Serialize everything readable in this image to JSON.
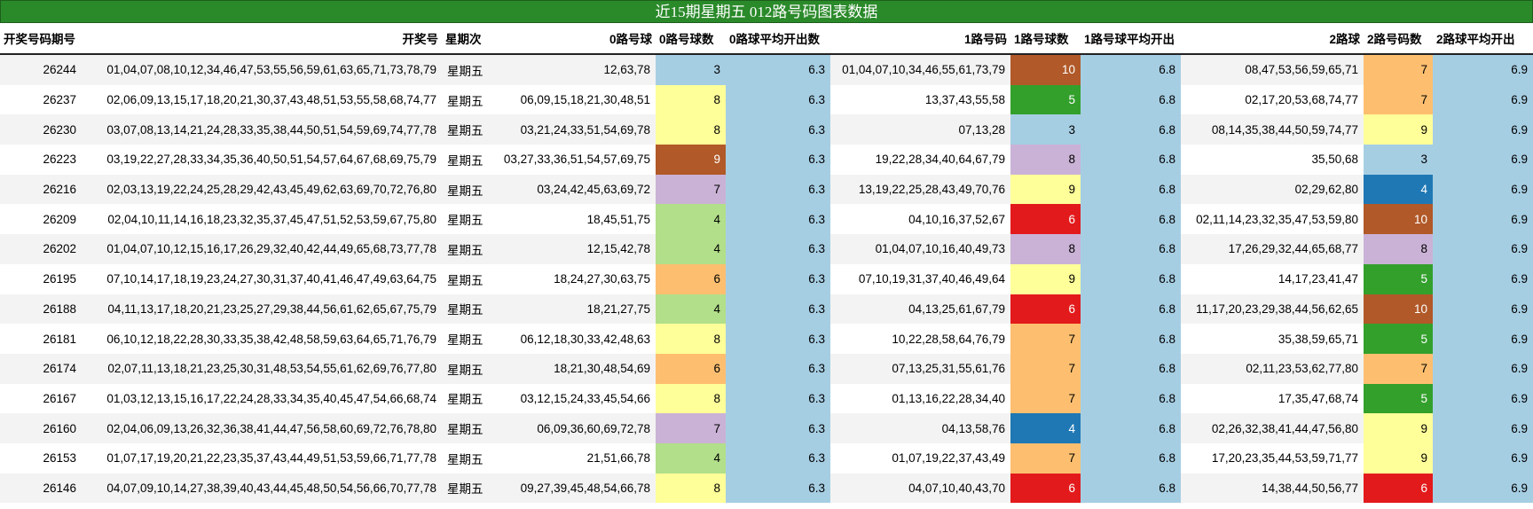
{
  "title": "近15期星期五 012路号码图表数据",
  "headers": [
    "开奖号码期号",
    "开奖号",
    "星期次",
    "0路号球",
    "0路号球数",
    "0路球平均开出数",
    "1路号码",
    "1路号球数",
    "1路号球平均开出",
    "2路球",
    "2路号码数",
    "2路球平均开出"
  ],
  "rows": [
    {
      "issue": "26244",
      "numbers": "01,04,07,08,10,12,34,46,47,53,55,56,59,61,63,65,71,73,78,79",
      "weekday": "星期五",
      "r0": "12,63,78",
      "c0": "3",
      "a0": "6.3",
      "r1": "01,04,07,10,34,46,55,61,73,79",
      "c1": "10",
      "a1": "6.8",
      "r2": "08,47,53,56,59,65,71",
      "c2": "7",
      "a2": "6.9"
    },
    {
      "issue": "26237",
      "numbers": "02,06,09,13,15,17,18,20,21,30,37,43,48,51,53,55,58,68,74,77",
      "weekday": "星期五",
      "r0": "06,09,15,18,21,30,48,51",
      "c0": "8",
      "a0": "6.3",
      "r1": "13,37,43,55,58",
      "c1": "5",
      "a1": "6.8",
      "r2": "02,17,20,53,68,74,77",
      "c2": "7",
      "a2": "6.9"
    },
    {
      "issue": "26230",
      "numbers": "03,07,08,13,14,21,24,28,33,35,38,44,50,51,54,59,69,74,77,78",
      "weekday": "星期五",
      "r0": "03,21,24,33,51,54,69,78",
      "c0": "8",
      "a0": "6.3",
      "r1": "07,13,28",
      "c1": "3",
      "a1": "6.8",
      "r2": "08,14,35,38,44,50,59,74,77",
      "c2": "9",
      "a2": "6.9"
    },
    {
      "issue": "26223",
      "numbers": "03,19,22,27,28,33,34,35,36,40,50,51,54,57,64,67,68,69,75,79",
      "weekday": "星期五",
      "r0": "03,27,33,36,51,54,57,69,75",
      "c0": "9",
      "a0": "6.3",
      "r1": "19,22,28,34,40,64,67,79",
      "c1": "8",
      "a1": "6.8",
      "r2": "35,50,68",
      "c2": "3",
      "a2": "6.9"
    },
    {
      "issue": "26216",
      "numbers": "02,03,13,19,22,24,25,28,29,42,43,45,49,62,63,69,70,72,76,80",
      "weekday": "星期五",
      "r0": "03,24,42,45,63,69,72",
      "c0": "7",
      "a0": "6.3",
      "r1": "13,19,22,25,28,43,49,70,76",
      "c1": "9",
      "a1": "6.8",
      "r2": "02,29,62,80",
      "c2": "4",
      "a2": "6.9"
    },
    {
      "issue": "26209",
      "numbers": "02,04,10,11,14,16,18,23,32,35,37,45,47,51,52,53,59,67,75,80",
      "weekday": "星期五",
      "r0": "18,45,51,75",
      "c0": "4",
      "a0": "6.3",
      "r1": "04,10,16,37,52,67",
      "c1": "6",
      "a1": "6.8",
      "r2": "02,11,14,23,32,35,47,53,59,80",
      "c2": "10",
      "a2": "6.9"
    },
    {
      "issue": "26202",
      "numbers": "01,04,07,10,12,15,16,17,26,29,32,40,42,44,49,65,68,73,77,78",
      "weekday": "星期五",
      "r0": "12,15,42,78",
      "c0": "4",
      "a0": "6.3",
      "r1": "01,04,07,10,16,40,49,73",
      "c1": "8",
      "a1": "6.8",
      "r2": "17,26,29,32,44,65,68,77",
      "c2": "8",
      "a2": "6.9"
    },
    {
      "issue": "26195",
      "numbers": "07,10,14,17,18,19,23,24,27,30,31,37,40,41,46,47,49,63,64,75",
      "weekday": "星期五",
      "r0": "18,24,27,30,63,75",
      "c0": "6",
      "a0": "6.3",
      "r1": "07,10,19,31,37,40,46,49,64",
      "c1": "9",
      "a1": "6.8",
      "r2": "14,17,23,41,47",
      "c2": "5",
      "a2": "6.9"
    },
    {
      "issue": "26188",
      "numbers": "04,11,13,17,18,20,21,23,25,27,29,38,44,56,61,62,65,67,75,79",
      "weekday": "星期五",
      "r0": "18,21,27,75",
      "c0": "4",
      "a0": "6.3",
      "r1": "04,13,25,61,67,79",
      "c1": "6",
      "a1": "6.8",
      "r2": "11,17,20,23,29,38,44,56,62,65",
      "c2": "10",
      "a2": "6.9"
    },
    {
      "issue": "26181",
      "numbers": "06,10,12,18,22,28,30,33,35,38,42,48,58,59,63,64,65,71,76,79",
      "weekday": "星期五",
      "r0": "06,12,18,30,33,42,48,63",
      "c0": "8",
      "a0": "6.3",
      "r1": "10,22,28,58,64,76,79",
      "c1": "7",
      "a1": "6.8",
      "r2": "35,38,59,65,71",
      "c2": "5",
      "a2": "6.9"
    },
    {
      "issue": "26174",
      "numbers": "02,07,11,13,18,21,23,25,30,31,48,53,54,55,61,62,69,76,77,80",
      "weekday": "星期五",
      "r0": "18,21,30,48,54,69",
      "c0": "6",
      "a0": "6.3",
      "r1": "07,13,25,31,55,61,76",
      "c1": "7",
      "a1": "6.8",
      "r2": "02,11,23,53,62,77,80",
      "c2": "7",
      "a2": "6.9"
    },
    {
      "issue": "26167",
      "numbers": "01,03,12,13,15,16,17,22,24,28,33,34,35,40,45,47,54,66,68,74",
      "weekday": "星期五",
      "r0": "03,12,15,24,33,45,54,66",
      "c0": "8",
      "a0": "6.3",
      "r1": "01,13,16,22,28,34,40",
      "c1": "7",
      "a1": "6.8",
      "r2": "17,35,47,68,74",
      "c2": "5",
      "a2": "6.9"
    },
    {
      "issue": "26160",
      "numbers": "02,04,06,09,13,26,32,36,38,41,44,47,56,58,60,69,72,76,78,80",
      "weekday": "星期五",
      "r0": "06,09,36,60,69,72,78",
      "c0": "7",
      "a0": "6.3",
      "r1": "04,13,58,76",
      "c1": "4",
      "a1": "6.8",
      "r2": "02,26,32,38,41,44,47,56,80",
      "c2": "9",
      "a2": "6.9"
    },
    {
      "issue": "26153",
      "numbers": "01,07,17,19,20,21,22,23,35,37,43,44,49,51,53,59,66,71,77,78",
      "weekday": "星期五",
      "r0": "21,51,66,78",
      "c0": "4",
      "a0": "6.3",
      "r1": "01,07,19,22,37,43,49",
      "c1": "7",
      "a1": "6.8",
      "r2": "17,20,23,35,44,53,59,71,77",
      "c2": "9",
      "a2": "6.9"
    },
    {
      "issue": "26146",
      "numbers": "04,07,09,10,14,27,38,39,40,43,44,45,48,50,54,56,66,70,77,78",
      "weekday": "星期五",
      "r0": "09,27,39,45,48,54,66,78",
      "c0": "8",
      "a0": "6.3",
      "r1": "04,07,10,40,43,70",
      "c1": "6",
      "a1": "6.8",
      "r2": "14,38,44,50,56,77",
      "c2": "6",
      "a2": "6.9"
    }
  ],
  "count_colors": {
    "3": "#a6cee3",
    "4": "#b2df8a",
    "5": "#33a02c",
    "6": "#fdbf6f",
    "7": "#fdbf6f",
    "8": "#ffff99",
    "9": "#ffff99",
    "10": "#b15928"
  },
  "count_colors_by_cell": {
    "c0": {
      "3": "#a6cee3",
      "4": "#b2df8a",
      "6": "#fdbf6f",
      "7": "#cab2d6",
      "8": "#ffff99",
      "9": "#b15928"
    },
    "c1": {
      "3": "#a6cee3",
      "4": "#1f78b4",
      "5": "#33a02c",
      "6": "#e31a1c",
      "7": "#fdbf6f",
      "8": "#cab2d6",
      "9": "#ffff99",
      "10": "#b15928"
    },
    "c2": {
      "3": "#a6cee3",
      "4": "#1f78b4",
      "5": "#33a02c",
      "6": "#e31a1c",
      "7": "#fdbf6f",
      "8": "#cab2d6",
      "9": "#ffff99",
      "10": "#b15928"
    }
  },
  "average_color": "#a6cee3",
  "title_bar_color": "#2a8a2a"
}
